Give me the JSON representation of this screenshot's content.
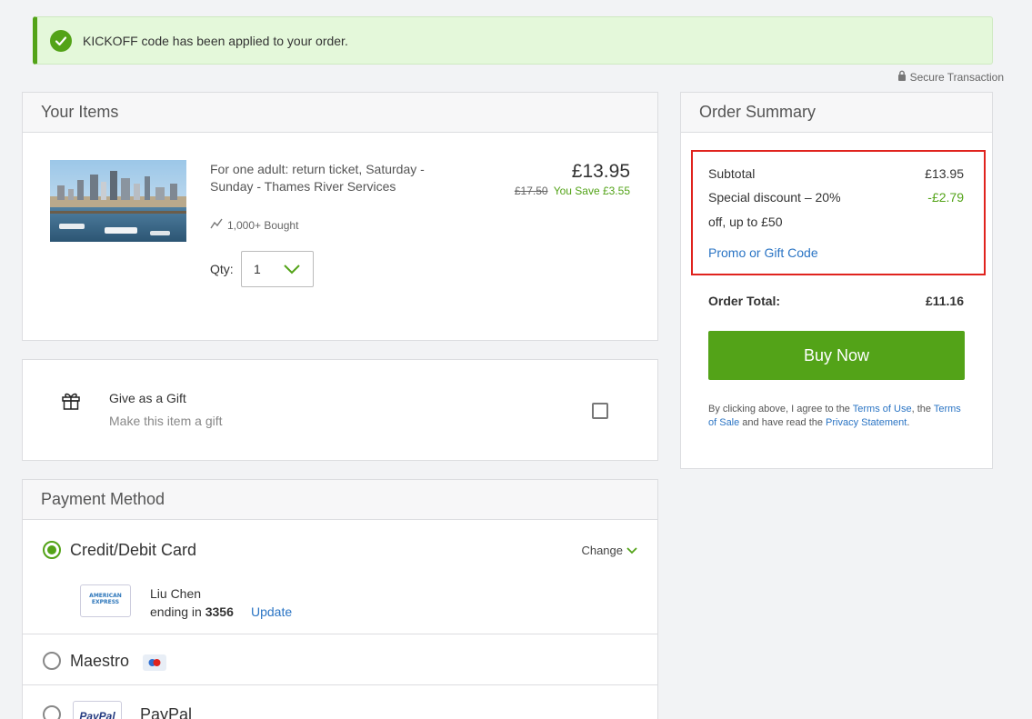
{
  "alert": {
    "message": "KICKOFF code has been applied to your order."
  },
  "secure": {
    "label": "Secure Transaction"
  },
  "items": {
    "heading": "Your Items",
    "item": {
      "title": "For one adult: return ticket, Saturday - Sunday - Thames River Services",
      "bought": "1,000+ Bought",
      "price": "£13.95",
      "old_price": "£17.50",
      "savings": "You Save £3.55",
      "qty_label": "Qty:",
      "qty_value": "1"
    }
  },
  "gift": {
    "title": "Give as a Gift",
    "subtitle": "Make this item a gift"
  },
  "payment": {
    "heading": "Payment Method",
    "methods": [
      {
        "label": "Credit/Debit Card",
        "selected": true,
        "change": "Change",
        "cardholder": "Liu Chen",
        "ending_prefix": "ending in",
        "ending_digits": "3356",
        "update": "Update",
        "card_brand_line1": "AMERICAN",
        "card_brand_line2": "EXPRESS"
      },
      {
        "label": "Maestro",
        "selected": false
      },
      {
        "label": "PayPal",
        "selected": false,
        "logo_text": "PayPal"
      }
    ]
  },
  "summary": {
    "heading": "Order Summary",
    "subtotal_label": "Subtotal",
    "subtotal_value": "£13.95",
    "discount_label_1": "Special discount – 20%",
    "discount_label_2": "off, up to £50",
    "discount_value": "-£2.79",
    "promo_link": "Promo or Gift Code",
    "total_label": "Order Total:",
    "total_value": "£11.16",
    "buy_button": "Buy Now",
    "legal": {
      "p1": "By clicking above, I agree to the ",
      "terms_use": "Terms of Use",
      "p2": ", the ",
      "terms_sale": "Terms of Sale",
      "p3": " and have read the ",
      "privacy": "Privacy Statement",
      "p4": "."
    }
  },
  "colors": {
    "accent_green": "#53a318",
    "link_blue": "#2a74c4",
    "highlight_red": "#e0231e"
  }
}
